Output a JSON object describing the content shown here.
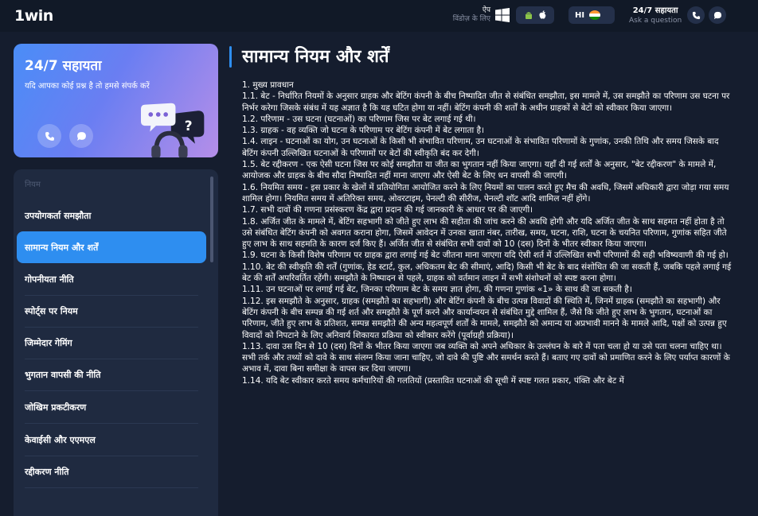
{
  "header": {
    "logo": "1win",
    "app_label_1": "ऐप",
    "app_label_2": "विंडोज़ के लिए",
    "language": "HI",
    "support_title": "24/7 सहायता",
    "support_sub": "Ask a question",
    "icons": [
      "windows-icon",
      "android-icon",
      "apple-icon",
      "phone-icon",
      "chat-icon"
    ]
  },
  "support_card": {
    "title": "24/7 सहायता",
    "desc": "यदि आपका कोई प्रश्न है तो हमसे संपर्क करें",
    "icons": [
      "phone-icon",
      "chat-icon"
    ]
  },
  "nav": {
    "section": "नियम",
    "items": [
      {
        "label": "उपयोगकर्ता समझौता",
        "active": false
      },
      {
        "label": "सामान्य नियम और शर्तें",
        "active": true
      },
      {
        "label": "गोपनीयता नीति",
        "active": false
      },
      {
        "label": "स्पोर्ट्स पर नियम",
        "active": false
      },
      {
        "label": "जिम्मेदार गेमिंग",
        "active": false
      },
      {
        "label": "भुगतान वापसी की नीति",
        "active": false
      },
      {
        "label": "जोखिम प्रकटीकरण",
        "active": false
      },
      {
        "label": "केवाईसी और एएमएल",
        "active": false
      },
      {
        "label": "रद्दीकरण नीति",
        "active": false
      }
    ]
  },
  "content": {
    "title": "सामान्य नियम और शर्तें",
    "paragraphs": [
      "1. मुख्य प्रावधान",
      "1.1. बेट - निर्धारित नियमों के अनुसार ग्राहक और बेटिंग कंपनी के बीच निष्पादित जीत से संबंधित समझौता, इस मामले में, उस समझौते का परिणाम उस घटना पर निर्भर करेगा जिसके संबंध में यह अज्ञात है कि यह घटित होगा या नहीं। बेटिंग कंपनी की शर्तों के अधीन ग्राहकों से बेटों को स्वीकार किया जाएगा।",
      "1.2. परिणाम - उस घटना (घटनाओं) का परिणाम जिस पर बेट लगाई गई थी।",
      "1.3. ग्राहक - वह व्यक्ति जो घटना के परिणाम पर बेटिंग कंपनी में बेट लगाता है।",
      "1.4. लाइन - घटनाओं का योग, उन घटनाओं के किसी भी संभावित परिणाम, उन घटनाओं के संभावित परिणामों के गुणांक, उनकी तिथि और समय जिसके बाद बेटिंग कंपनी उल्लिखित घटनाओं के परिणामों पर बेटों की स्वीकृति बंद कर देगी।",
      "1.5. बेट रद्दीकरण - एक ऐसी घटना जिस पर कोई समझौता या जीत का भुगतान नहीं किया जाएगा। यहाँ दी गई शर्तों के अनुसार, \"बेट रद्दीकरण\" के मामले में, आयोजक और ग्राहक के बीच सौदा निष्पादित नहीं माना जाएगा और ऐसी बेट के लिए धन वापसी की जाएगी।",
      "1.6. नियमित समय - इस प्रकार के खेलों में प्रतियोगिता आयोजित करने के लिए नियमों का पालन करते हुए मैच की अवधि, जिसमें अधिकारी द्वारा जोड़ा गया समय शामिल होगा। नियमित समय में अतिरिक्त समय, ओवरटाइम, पेनल्टी की सीरीज, पेनल्टी शॉट आदि शामिल नहीं होंगे।",
      "1.7. सभी दावों की गणना प्रसंस्करण केंद्र द्वारा प्रदान की गई जानकारी के आधार पर की जाएगी।",
      "1.8. अर्जित जीत के मामले में, बेटिंग सहभागी को जीते हुए लाभ की सहीता की जांच करने की अवधि होगी और यदि अर्जित जीत के साथ सहमत नहीं होता है तो उसे संबंधित बेटिंग कंपनी को अवगत कराना होगा, जिसमें आवेदन में उनका खाता नंबर, तारीख, समय, घटना, राशि, घटना के चयनित परिणाम, गुणांक सहित जीते हुए लाभ के साथ सहमति के कारण दर्ज किए हैं। अर्जित जीत से संबंधित सभी दावों को 10 (दस) दिनों के भीतर स्वीकार किया जाएगा।",
      "1.9. घटना के किसी विशेष परिणाम पर ग्राहक द्वारा लगाई गई बेट जीतना माना जाएगा यदि ऐसी शर्त में उल्लिखित सभी परिणामों की सही भविष्यवाणी की गई हो।",
      "1.10. बेट की स्वीकृति की शर्तें (गुणांक, हेड स्टार्ट, कुल, अधिकतम बेट की सीमाएं, आदि) किसी भी बेट के बाद संशोधित की जा सकती हैं, जबकि पहले लगाई गई बेट की शर्तें अपरिवर्तित रहेंगी। समझौते के निष्पादन से पहले, ग्राहक को वर्तमान लाइन में सभी संशोधनों को स्पष्ट करना होगा।",
      "1.11. उन घटनाओं पर लगाई गई बेट, जिनका परिणाम बेट के समय ज्ञात होगा, की गणना गुणांक «1» के साथ की जा सकती है।",
      "1.12. इस समझौते के अनुसार, ग्राहक (समझौते का सहभागी) और बेटिंग कंपनी के बीच उत्पन्न विवादों की स्थिति में, जिनमें ग्राहक (समझौते का सहभागी) और बेटिंग कंपनी के बीच सम्पन्न की गई शर्त और समझौते के पूर्ण करने और कार्यान्वयन से संबंधित मुद्दे शामिल हैं, जैसे कि जीते हुए लाभ के भुगतान, घटनाओं का परिणाम, जीते हुए लाभ के प्रतिशत, सम्पन्न समझौते की अन्य महत्वपूर्ण शर्तों के मामले, समझौते को अमान्य या अप्रभावी मानने के मामले आदि, पक्षों को उत्पन्न हुए विवादों को निपटाने के लिए अनिवार्य शिकायत प्रक्रिया को स्वीकार करेंगे (पूर्वाग्रही प्रक्रिया)।",
      "1.13. दावा उस दिन से 10 (दस) दिनों के भीतर किया जाएगा जब व्यक्ति को अपने अधिकार के उल्लंघन के बारे में पता चला हो या उसे पता चलना चाहिए था। सभी तर्क और तथ्यों को दावे के साथ संलग्न किया जाना चाहिए, जो दावे की पुष्टि और समर्थन करते हैं। बताए गए दावों को प्रमाणित करने के लिए पर्याप्त कारणों के अभाव में, दावा बिना समीक्षा के वापस कर दिया जाएगा।",
      "1.14. यदि बेट स्वीकार करते समय कर्मचारियों की गलतियों (प्रस्तावित घटनाओं की सूची में स्पष्ट गलत प्रकार, पंक्ति और बेट में"
    ]
  }
}
